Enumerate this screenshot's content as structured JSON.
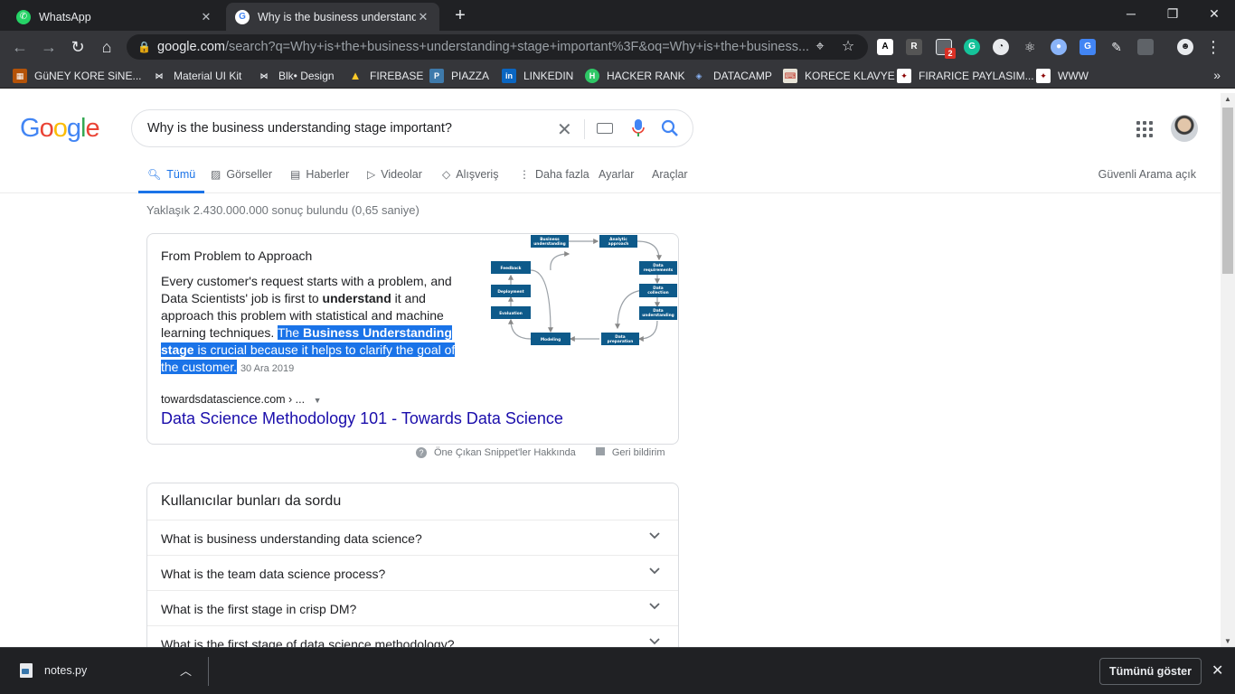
{
  "browser": {
    "tabs": [
      {
        "title": "WhatsApp",
        "icon": "whatsapp-icon",
        "color": "#25d366"
      },
      {
        "title": "Why is the business understandin",
        "icon": "google-icon",
        "color": "#ffffff"
      }
    ],
    "url_host": "google.com",
    "url_rest": "/search?q=Why+is+the+business+understanding+stage+important%3F&oq=Why+is+the+business...",
    "bookmarks": [
      {
        "label": "GüNEY KORE SiNE...",
        "icon": "film-icon",
        "color": "#b45309"
      },
      {
        "label": "Material UI Kit",
        "icon": "bow-icon",
        "color": "#111111"
      },
      {
        "label": "Blk• Design",
        "icon": "bow-icon",
        "color": "#111111"
      },
      {
        "label": "FIREBASE",
        "icon": "firebase-icon",
        "color": "#ffca28"
      },
      {
        "label": "PIAZZA",
        "icon": "piazza-icon",
        "color": "#3e7aab"
      },
      {
        "label": "LINKEDIN",
        "icon": "linkedin-icon",
        "color": "#0a66c2"
      },
      {
        "label": "HACKER RANK",
        "icon": "hackerrank-icon",
        "color": "#2ec866"
      },
      {
        "label": "DATACAMP",
        "icon": "datacamp-icon",
        "color": "#03ef62"
      },
      {
        "label": "KORECE KLAVYE",
        "icon": "keyboard-icon",
        "color": "#c0392b"
      },
      {
        "label": "FIRARICE PAYLASIM...",
        "icon": "share-icon",
        "color": "#8b0000"
      },
      {
        "label": "WWW",
        "icon": "www-icon",
        "color": "#8b0000"
      }
    ],
    "extension_badge": "2"
  },
  "search": {
    "logo": [
      "G",
      "o",
      "o",
      "g",
      "l",
      "e"
    ],
    "logo_colors": [
      "#4285f4",
      "#ea4335",
      "#fbbc05",
      "#4285f4",
      "#34a853",
      "#ea4335"
    ],
    "query": "Why is the business understanding stage important?",
    "tabs": [
      "Tümü",
      "Görseller",
      "Haberler",
      "Videolar",
      "Alışveriş",
      "Daha fazla",
      "Ayarlar",
      "Araçlar"
    ],
    "safe_search": "Güvenli Arama açık",
    "stats": "Yaklaşık 2.430.000.000 sonuç bulundu (0,65 saniye)"
  },
  "snippet": {
    "heading": "From Problem to Approach",
    "text_before": "Every customer's request starts with a problem, and Data Scientists' job is first to ",
    "text_bold": "understand",
    "text_mid": " it and approach this problem with statistical and machine learning techniques. ",
    "hl_1": "The ",
    "hl_bold": "Business Understanding stage",
    "hl_2": " is crucial because it helps to clarify the goal of the customer.",
    "date": "30 Ara 2019",
    "source": "towardsdatascience.com › ...",
    "link": "Data Science Methodology 101 - Towards Data Science",
    "diagram_boxes": {
      "business": [
        "Business",
        "understanding"
      ],
      "analytic": [
        "Analytic",
        "approach"
      ],
      "data_req": [
        "Data",
        "requirements"
      ],
      "data_col": [
        "Data",
        "collection"
      ],
      "data_und": [
        "Data",
        "understanding"
      ],
      "data_prep": [
        "Data",
        "preparation"
      ],
      "modeling": "Modeling",
      "evaluation": "Evaluation",
      "deployment": "Deployment",
      "feedback": "Feedback"
    }
  },
  "snippet_footer": {
    "about": "Öne Çıkan Snippet'ler Hakkında",
    "feedback": "Geri bildirim"
  },
  "paa": {
    "title": "Kullanıcılar bunları da sordu",
    "questions": [
      "What is business understanding data science?",
      "What is the team data science process?",
      "What is the first stage in crisp DM?",
      "What is the first stage of data science methodology?"
    ]
  },
  "downloads": {
    "file": "notes.py",
    "show_all": "Tümünü göster"
  }
}
